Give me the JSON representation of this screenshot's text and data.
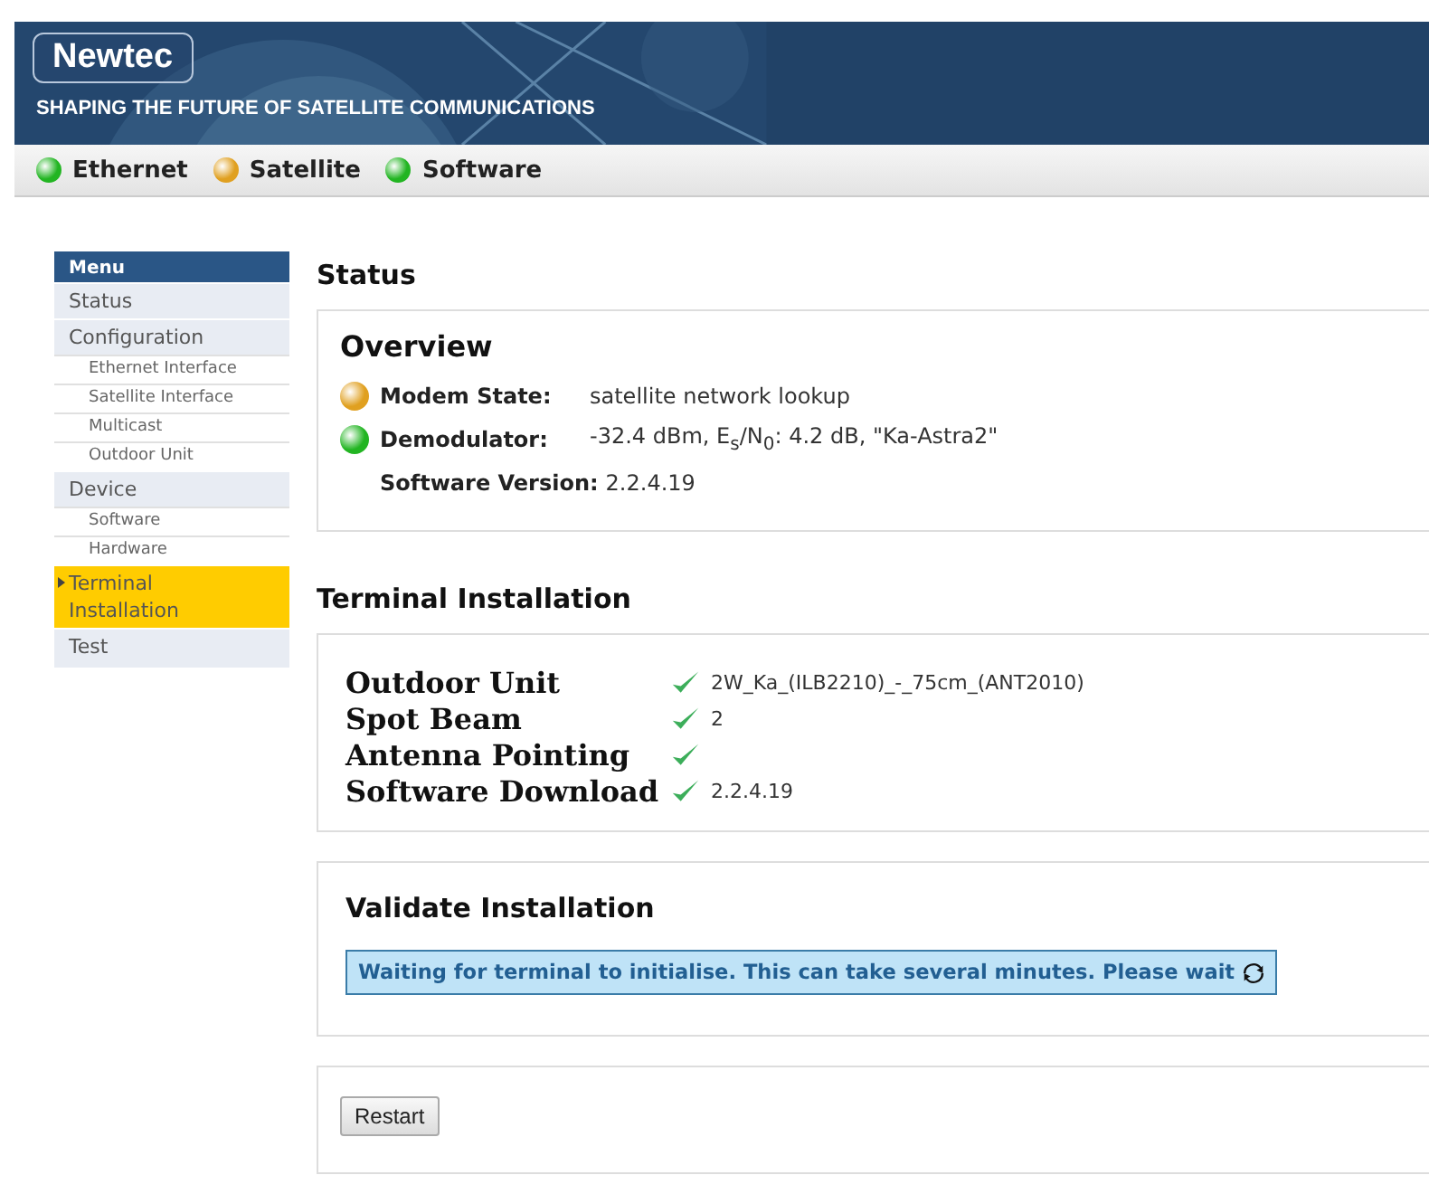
{
  "header": {
    "logo": "Newtec",
    "tagline": "SHAPING THE FUTURE OF SATELLITE COMMUNICATIONS"
  },
  "indicators": [
    {
      "label": "Ethernet",
      "color": "#22b522"
    },
    {
      "label": "Satellite",
      "color": "#e0a020"
    },
    {
      "label": "Software",
      "color": "#22b522"
    }
  ],
  "menu": {
    "title": "Menu",
    "items": [
      {
        "label": "Status",
        "selected": false
      },
      {
        "label": "Configuration",
        "selected": false,
        "children": [
          {
            "label": "Ethernet Interface",
            "selected": false
          },
          {
            "label": "Satellite Interface",
            "selected": false
          },
          {
            "label": "Multicast",
            "selected": false
          },
          {
            "label": "Outdoor Unit",
            "selected": false
          }
        ]
      },
      {
        "label": "Device",
        "selected": false,
        "children": [
          {
            "label": "Software",
            "selected": false
          },
          {
            "label": "Hardware",
            "selected": false
          }
        ]
      },
      {
        "label": "Terminal Installation",
        "selected": true
      },
      {
        "label": "Test",
        "selected": false
      }
    ]
  },
  "page_title": "Status",
  "overview": {
    "title": "Overview",
    "rows": [
      {
        "label": "Modem State:",
        "value": "satellite network lookup",
        "color": "#e0a020"
      },
      {
        "label": "Demodulator:",
        "value": "-32.4 dBm, E$_{s}$/N$_{0}$: 4.2 dB, \"Ka-Astra2\"",
        "color": "#22b522"
      },
      {
        "label": "Software Version:",
        "value": "2.2.4.19"
      }
    ]
  },
  "installation": {
    "title": "Terminal Installation",
    "rows": [
      {
        "label": "Outdoor Unit",
        "checked": true,
        "value": "2W_Ka_(ILB2210)_-_75cm_(ANT2010)"
      },
      {
        "label": "Spot Beam",
        "checked": true,
        "value": "2"
      },
      {
        "label": "Antenna Pointing",
        "checked": true
      },
      {
        "label": "Software Download",
        "checked": true,
        "value": "2.2.4.19"
      }
    ]
  },
  "validate": {
    "title": "Validate Installation",
    "message": "Waiting for terminal to initialise. This can take several minutes. Please wait"
  },
  "buttons": [
    "Restart"
  ]
}
